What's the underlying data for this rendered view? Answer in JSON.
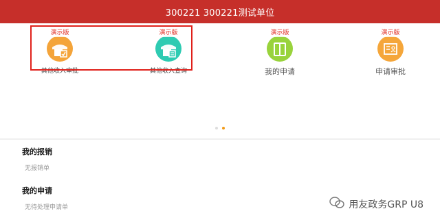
{
  "header": {
    "title": "300221 300221测试单位"
  },
  "apps": [
    {
      "label": "其他收入审批",
      "badge": "演示版",
      "color": "#f4a43a",
      "icon": "approval-doc-icon"
    },
    {
      "label": "其他收入查询",
      "badge": "演示版",
      "color": "#2ecbb2",
      "icon": "query-doc-icon"
    },
    {
      "label": "我的申请",
      "badge": "演示版",
      "color": "#99d33c",
      "icon": "book-icon"
    },
    {
      "label": "申请审批",
      "badge": "演示版",
      "color": "#f5a63a",
      "icon": "list-person-icon"
    }
  ],
  "pager": {
    "pages": 2,
    "active": 2
  },
  "sections": {
    "reimbursements": {
      "title": "我的报销",
      "empty": "无报销单"
    },
    "applications": {
      "title": "我的申请",
      "empty": "无待处理申请单"
    }
  },
  "watermark": {
    "text": "用友政务GRP U8"
  }
}
